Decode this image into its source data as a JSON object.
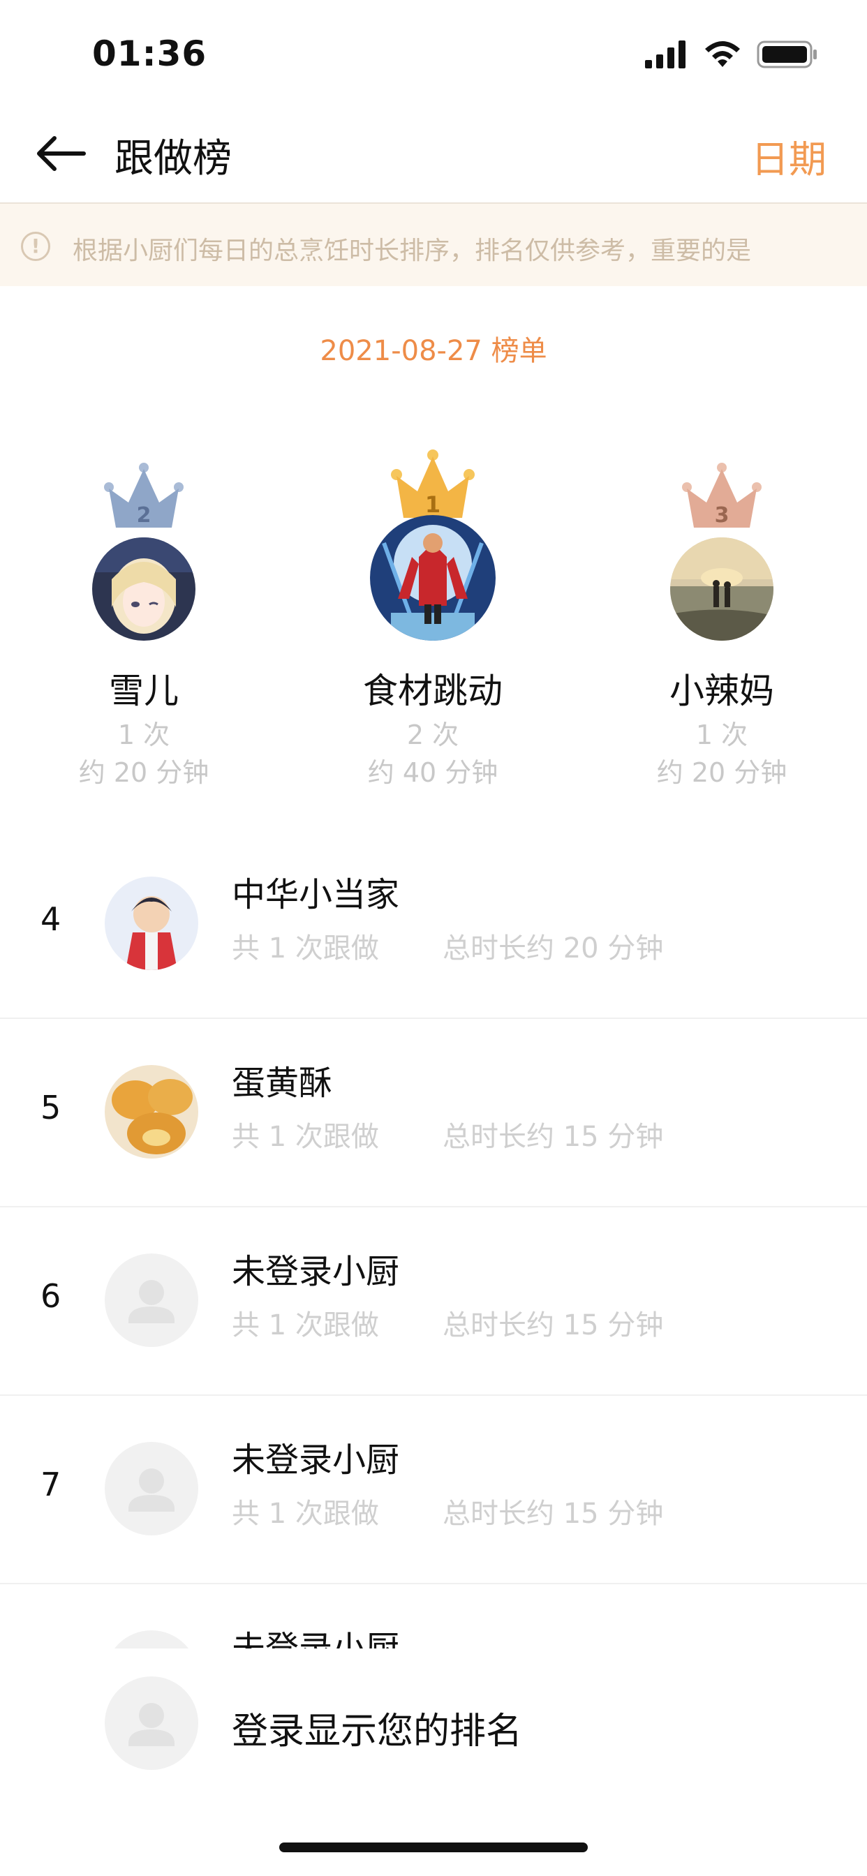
{
  "status_bar": {
    "time": "01:36"
  },
  "nav": {
    "title": "跟做榜",
    "date_button": "日期"
  },
  "notice": {
    "text": "根据小厨们每日的总烹饪时长排序，排名仅供参考，重要的是"
  },
  "board_date": "2021-08-27 榜单",
  "podium": {
    "first": {
      "rank": "1",
      "name": "食材跳动",
      "count": "2 次",
      "duration": "约 40 分钟"
    },
    "second": {
      "rank": "2",
      "name": "雪儿",
      "count": "1 次",
      "duration": "约 20 分钟"
    },
    "third": {
      "rank": "3",
      "name": "小辣妈",
      "count": "1 次",
      "duration": "约 20 分钟"
    }
  },
  "list": [
    {
      "rank": "4",
      "name": "中华小当家",
      "count": "共 1 次跟做",
      "duration": "总时长约 20 分钟"
    },
    {
      "rank": "5",
      "name": "蛋黄酥",
      "count": "共 1 次跟做",
      "duration": "总时长约 15 分钟"
    },
    {
      "rank": "6",
      "name": "未登录小厨",
      "count": "共 1 次跟做",
      "duration": "总时长约 15 分钟"
    },
    {
      "rank": "7",
      "name": "未登录小厨",
      "count": "共 1 次跟做",
      "duration": "总时长约 15 分钟"
    },
    {
      "rank": "",
      "name": "未登录小厨"
    }
  ],
  "login_prompt": "登录显示您的排名",
  "colors": {
    "accent": "#f29a52",
    "gold": "#f3b545",
    "silver": "#8fa6c8",
    "bronze": "#e2ab96"
  }
}
